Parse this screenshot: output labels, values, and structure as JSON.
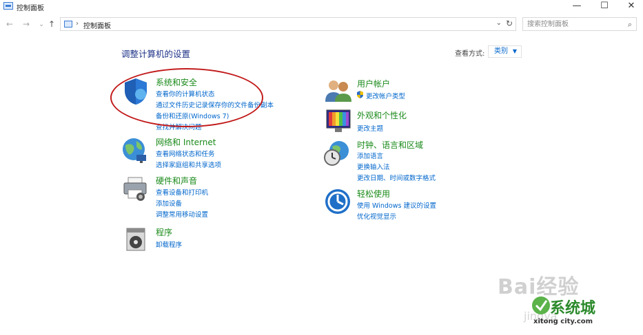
{
  "window": {
    "title": "控制面板",
    "min": "—",
    "max": "☐",
    "close": "✕"
  },
  "nav": {
    "back": "←",
    "forward": "→",
    "down": "⌄",
    "up": "↑"
  },
  "address": {
    "separator": "›",
    "path": "控制面板",
    "dropdown": "⌄",
    "refresh": "↻"
  },
  "search": {
    "placeholder": "搜索控制面板",
    "icon": "⌕"
  },
  "heading": "调整计算机的设置",
  "view": {
    "label": "查看方式:",
    "value": "类别",
    "caret": "▼"
  },
  "categories_left": [
    {
      "title": "系统和安全",
      "links": [
        "查看你的计算机状态",
        "通过文件历史记录保存你的文件备份副本",
        "备份和还原(Windows 7)",
        "查找并解决问题"
      ]
    },
    {
      "title": "网络和 Internet",
      "links": [
        "查看网络状态和任务",
        "选择家庭组和共享选项"
      ]
    },
    {
      "title": "硬件和声音",
      "links": [
        "查看设备和打印机",
        "添加设备",
        "调整常用移动设置"
      ]
    },
    {
      "title": "程序",
      "links": [
        "卸载程序"
      ]
    }
  ],
  "categories_right": [
    {
      "title": "用户帐户",
      "links": [
        "更改帐户类型"
      ]
    },
    {
      "title": "外观和个性化",
      "links": [
        "更改主题"
      ]
    },
    {
      "title": "时钟、语言和区域",
      "links": [
        "添加语言",
        "更换输入法",
        "更改日期、时间或数字格式"
      ]
    },
    {
      "title": "轻松使用",
      "links": [
        "使用 Windows 建议的设置",
        "优化视觉显示"
      ]
    }
  ],
  "watermark": {
    "baidu": "Bai经验",
    "jingyan": "jingya",
    "logo": "系统城",
    "logo_sub": "xitong city.com"
  }
}
